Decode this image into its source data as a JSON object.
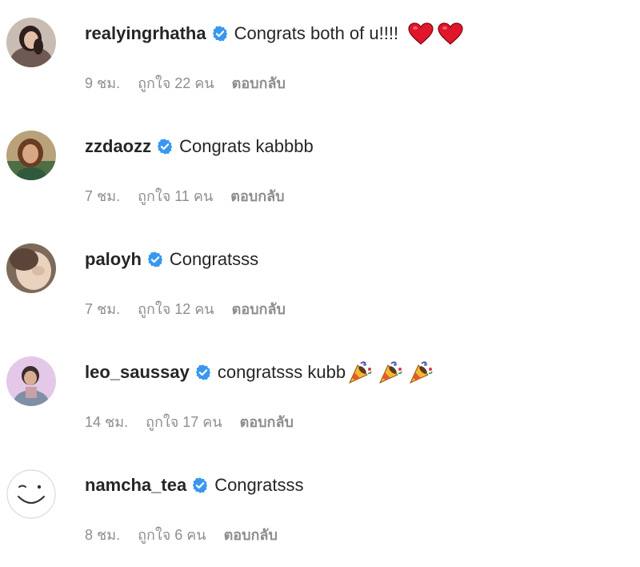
{
  "comments": [
    {
      "username": "realyingrhatha",
      "text": "Congrats both of u!!!!",
      "emoji": [
        "red-heart",
        "red-heart"
      ],
      "time": "9 ชม.",
      "likes": "ถูกใจ 22 คน",
      "reply": "ตอบกลับ"
    },
    {
      "username": "zzdaozz",
      "text": "Congrats kabbbb",
      "emoji": [],
      "time": "7 ชม.",
      "likes": "ถูกใจ 11 คน",
      "reply": "ตอบกลับ"
    },
    {
      "username": "paloyh",
      "text": "Congratsss",
      "emoji": [],
      "time": "7 ชม.",
      "likes": "ถูกใจ 12 คน",
      "reply": "ตอบกลับ"
    },
    {
      "username": "leo_saussay",
      "text": "congratsss kubb",
      "emoji": [
        "party-popper",
        "party-popper",
        "party-popper"
      ],
      "time": "14 ชม.",
      "likes": "ถูกใจ 17 คน",
      "reply": "ตอบกลับ"
    },
    {
      "username": "namcha_tea",
      "text": "Congratsss",
      "emoji": [],
      "time": "8 ชม.",
      "likes": "ถูกใจ 6 คน",
      "reply": "ตอบกลับ"
    }
  ],
  "colors": {
    "verified": "#3897f0",
    "meta_text": "#8e8e8e",
    "heart": "#e0162b"
  }
}
